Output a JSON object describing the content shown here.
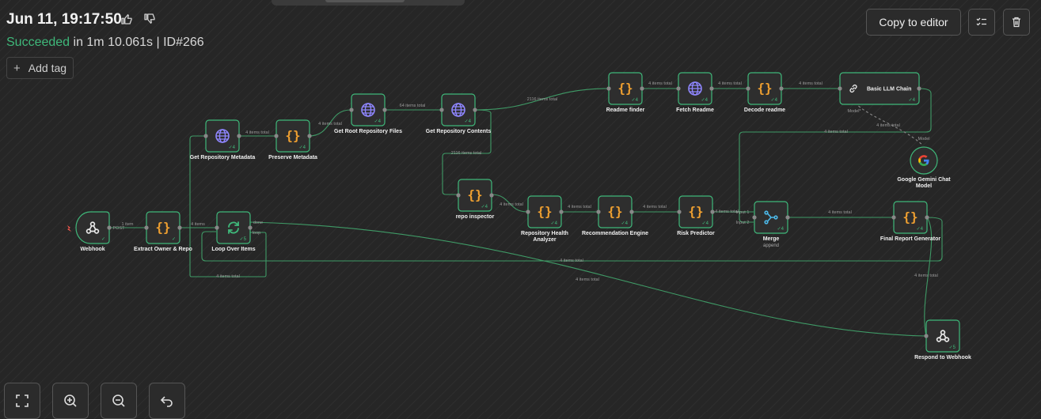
{
  "header": {
    "date": "Jun 11, 19:17:50",
    "status": "Succeeded",
    "duration": " in 1m 10.061s",
    "separator": " | ",
    "exec_id": "ID#266",
    "add_tag": "Add tag",
    "copy_to_editor": "Copy to editor"
  },
  "colors": {
    "accent": "#3fb87a",
    "curly": "#f0a030",
    "globe": "#8f86ff",
    "trigger": "#ff5a4f",
    "edge": "#3f9a66"
  },
  "nodes": [
    {
      "id": "webhook",
      "label": "Webhook",
      "icon": "webhook-icon",
      "items": ""
    },
    {
      "id": "extract",
      "label": "Extract Owner & Repo",
      "icon": "curly-braces-icon",
      "items": ""
    },
    {
      "id": "loop",
      "label": "Loop Over Items",
      "icon": "loop-icon",
      "items": "5"
    },
    {
      "id": "meta",
      "label": "Get Repository Metadata",
      "icon": "globe-icon",
      "items": "4"
    },
    {
      "id": "preserve",
      "label": "Preserve Metadata",
      "icon": "curly-braces-icon",
      "items": "4"
    },
    {
      "id": "rootfiles",
      "label": "Get Root Repository Files",
      "icon": "globe-icon",
      "items": "4"
    },
    {
      "id": "contents",
      "label": "Get Repository Contents",
      "icon": "globe-icon",
      "items": "4"
    },
    {
      "id": "readmefinder",
      "label": "Readme finder",
      "icon": "curly-braces-icon",
      "items": "4"
    },
    {
      "id": "fetchreadme",
      "label": "Fetch Readme",
      "icon": "globe-icon",
      "items": "4"
    },
    {
      "id": "decode",
      "label": "Decode readme",
      "icon": "curly-braces-icon",
      "items": "4"
    },
    {
      "id": "llm",
      "label": "Basic LLM Chain",
      "icon": "link-icon",
      "items": "4"
    },
    {
      "id": "gemini",
      "label1": "Google Gemini Chat",
      "label2": "Model",
      "icon": "google-icon"
    },
    {
      "id": "inspector",
      "label": "repo inspector",
      "icon": "curly-braces-icon",
      "items": "4"
    },
    {
      "id": "health",
      "label1": "Repository Health",
      "label2": "Analyzer",
      "icon": "curly-braces-icon",
      "items": "4"
    },
    {
      "id": "recommend",
      "label": "Recommendation Engine",
      "icon": "curly-braces-icon",
      "items": "4"
    },
    {
      "id": "risk",
      "label": "Risk Predictor",
      "icon": "curly-braces-icon",
      "items": "4"
    },
    {
      "id": "merge",
      "label": "Merge",
      "sub": "append",
      "icon": "merge-icon",
      "items": "4"
    },
    {
      "id": "final",
      "label": "Final Report Generator",
      "icon": "curly-braces-icon",
      "items": "4"
    },
    {
      "id": "respond",
      "label": "Respond to Webhook",
      "icon": "webhook-icon",
      "items": "5"
    }
  ],
  "edges": {
    "e1": "1 item",
    "e1b": "POST",
    "e2": "4 items",
    "e3": "4 items total",
    "e4": "4 items total",
    "e5": "64 items total",
    "e6": "2116 items total",
    "e7": "4 items total",
    "e8": "4 items total",
    "e9": "4 items total",
    "e10": "2116 items total",
    "e11": "4 items total",
    "e12": "4 items total",
    "e13": "4 items total",
    "e14": "4 items total",
    "e15": "4 items total",
    "e16": "4 items total",
    "e17": "4 items total",
    "e18": "4 items total",
    "e19": "4 items total",
    "e20": "4 items total",
    "done": "done",
    "loop": "loop",
    "model": "Model",
    "model_req": "Model*",
    "in1": "Input 1",
    "in2": "Input 2"
  }
}
